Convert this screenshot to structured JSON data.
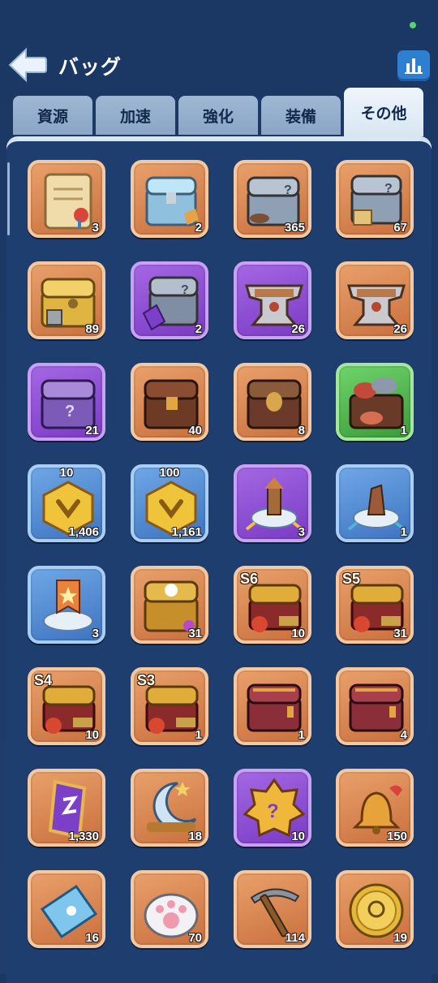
{
  "header": {
    "title": "バッグ",
    "back_icon": "back-arrow-icon",
    "stats_icon": "bar-chart-icon",
    "status_color": "#56d36b"
  },
  "tabs": [
    {
      "label": "資源",
      "active": false
    },
    {
      "label": "加速",
      "active": false
    },
    {
      "label": "強化",
      "active": false
    },
    {
      "label": "装備",
      "active": false
    },
    {
      "label": "その他",
      "active": true
    }
  ],
  "items": [
    {
      "name": "scroll-icon",
      "rarity": "orange",
      "count": "3"
    },
    {
      "name": "crystal-chest-icon",
      "rarity": "orange",
      "count": "2"
    },
    {
      "name": "mystery-chest-icon",
      "rarity": "orange",
      "count": "365"
    },
    {
      "name": "mystery-chest-scroll-icon",
      "rarity": "orange",
      "count": "67"
    },
    {
      "name": "golden-chest-icon",
      "rarity": "orange",
      "count": "89"
    },
    {
      "name": "rune-chest-icon",
      "rarity": "purple",
      "count": "2"
    },
    {
      "name": "anvil-icon",
      "rarity": "purple",
      "count": "26"
    },
    {
      "name": "anvil-icon",
      "rarity": "orange",
      "count": "26"
    },
    {
      "name": "purple-mystery-chest-icon",
      "rarity": "purple",
      "count": "21"
    },
    {
      "name": "treasure-chest-icon",
      "rarity": "orange",
      "count": "40"
    },
    {
      "name": "skull-chest-icon",
      "rarity": "orange",
      "count": "8"
    },
    {
      "name": "meat-chest-icon",
      "rarity": "green",
      "count": "1"
    },
    {
      "name": "hex-token-icon",
      "rarity": "blue",
      "count": "1,406",
      "badge": "10"
    },
    {
      "name": "hex-token-icon",
      "rarity": "blue",
      "count": "1,161",
      "badge": "100"
    },
    {
      "name": "tower-relocate-icon",
      "rarity": "purple",
      "count": "3"
    },
    {
      "name": "statue-relocate-icon",
      "rarity": "blue",
      "count": "1"
    },
    {
      "name": "banner-relocate-icon",
      "rarity": "blue",
      "count": "3"
    },
    {
      "name": "paw-chest-icon",
      "rarity": "orange",
      "count": "31"
    },
    {
      "name": "season-chest-icon",
      "rarity": "orange",
      "count": "10",
      "season": "S6"
    },
    {
      "name": "season-chest-icon",
      "rarity": "orange",
      "count": "31",
      "season": "S5"
    },
    {
      "name": "season-chest-icon",
      "rarity": "orange",
      "count": "10",
      "season": "S4"
    },
    {
      "name": "season-chest-icon",
      "rarity": "orange",
      "count": "1",
      "season": "S3"
    },
    {
      "name": "red-chest-icon",
      "rarity": "orange",
      "count": "1"
    },
    {
      "name": "red-chest-icon",
      "rarity": "orange",
      "count": "4"
    },
    {
      "name": "rune-stone-icon",
      "rarity": "orange",
      "count": "1,330"
    },
    {
      "name": "crescent-moon-icon",
      "rarity": "orange",
      "count": "18"
    },
    {
      "name": "mystery-compass-icon",
      "rarity": "purple",
      "count": "10"
    },
    {
      "name": "bell-icon",
      "rarity": "orange",
      "count": "150"
    },
    {
      "name": "ticket-icon",
      "rarity": "orange",
      "count": "16"
    },
    {
      "name": "paw-cushion-icon",
      "rarity": "orange",
      "count": "70"
    },
    {
      "name": "pickaxe-icon",
      "rarity": "orange",
      "count": "114"
    },
    {
      "name": "gold-coin-icon",
      "rarity": "orange",
      "count": "19"
    }
  ]
}
